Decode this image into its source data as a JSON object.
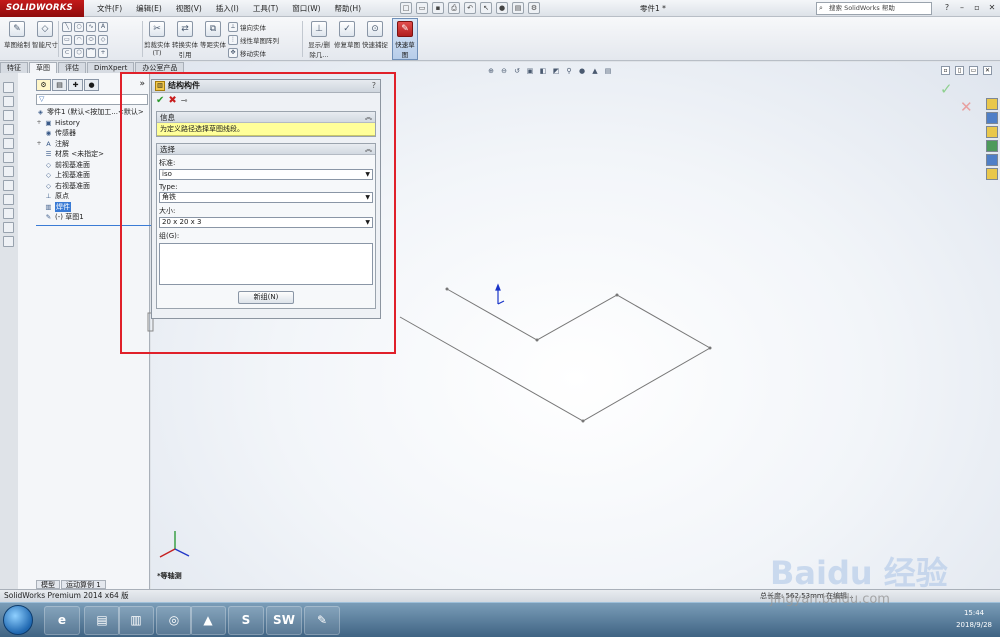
{
  "app": {
    "logo": "SOLIDWORKS",
    "menus": [
      "文件(F)",
      "编辑(E)",
      "视图(V)",
      "插入(I)",
      "工具(T)",
      "窗口(W)",
      "帮助(H)"
    ],
    "doc_title": "零件1 *",
    "search_placeholder": "搜索 SolidWorks 帮助"
  },
  "commands": {
    "sketch_draw": "草图绘制",
    "smart_dim": "智能尺寸",
    "trim": "剪裁实体(T)",
    "convert": "转换实体引用",
    "offset": "等距实体",
    "mirror": "镜向实体",
    "linear_pattern": "线性草图阵列",
    "move": "移动实体",
    "display_delete": "显示/删除几...",
    "repair": "修复草图",
    "quick_snap": "快速捕捉",
    "quick_sketch": "快速草图"
  },
  "cm_tabs": [
    "特征",
    "草图",
    "评估",
    "DimXpert",
    "办公室产品"
  ],
  "tree": {
    "filter": "▽",
    "root": "零件1 (默认<按加工...<默认>",
    "items": [
      {
        "label": "History",
        "icon": "history-icon",
        "expand": "+"
      },
      {
        "label": "传感器",
        "icon": "sensor-icon",
        "expand": ""
      },
      {
        "label": "注解",
        "icon": "annotation-icon",
        "expand": "+"
      },
      {
        "label": "材质 <未指定>",
        "icon": "material-icon",
        "expand": ""
      },
      {
        "label": "前视基准面",
        "icon": "plane-icon",
        "expand": ""
      },
      {
        "label": "上视基准面",
        "icon": "plane-icon",
        "expand": ""
      },
      {
        "label": "右视基准面",
        "icon": "plane-icon",
        "expand": ""
      },
      {
        "label": "原点",
        "icon": "origin-icon",
        "expand": ""
      },
      {
        "label": "焊件",
        "icon": "weldment-icon",
        "expand": "",
        "selected": true
      },
      {
        "label": "(-) 草图1",
        "icon": "sketch-icon",
        "expand": ""
      }
    ]
  },
  "pm": {
    "title": "结构构件",
    "help": "?",
    "info_title": "信息",
    "info_msg": "为定义路径选择草图线段。",
    "select_title": "选择",
    "standard_label": "标准:",
    "standard_value": "iso",
    "type_label": "Type:",
    "type_value": "角铁",
    "size_label": "大小:",
    "size_value": "20 x 20 x 3",
    "group_label": "组(G):",
    "new_group": "新组(N)"
  },
  "view": {
    "triad_label": "*等轴测"
  },
  "bottom_tabs": [
    "模型",
    "运动算例 1"
  ],
  "status": {
    "text": "SolidWorks Premium 2014 x64 版",
    "right": "总长度: 562.53mm  在编辑..."
  },
  "clock": {
    "time": "15:44",
    "date": "2018/9/28"
  },
  "watermark": {
    "line1": "Baidu 经验",
    "line2": "jingyan.baidu.com"
  },
  "colors": {
    "brand": "#c41a1a",
    "highlight": "#ffff99",
    "selection": "#3a7bd5",
    "annotation": "#e0202a"
  }
}
